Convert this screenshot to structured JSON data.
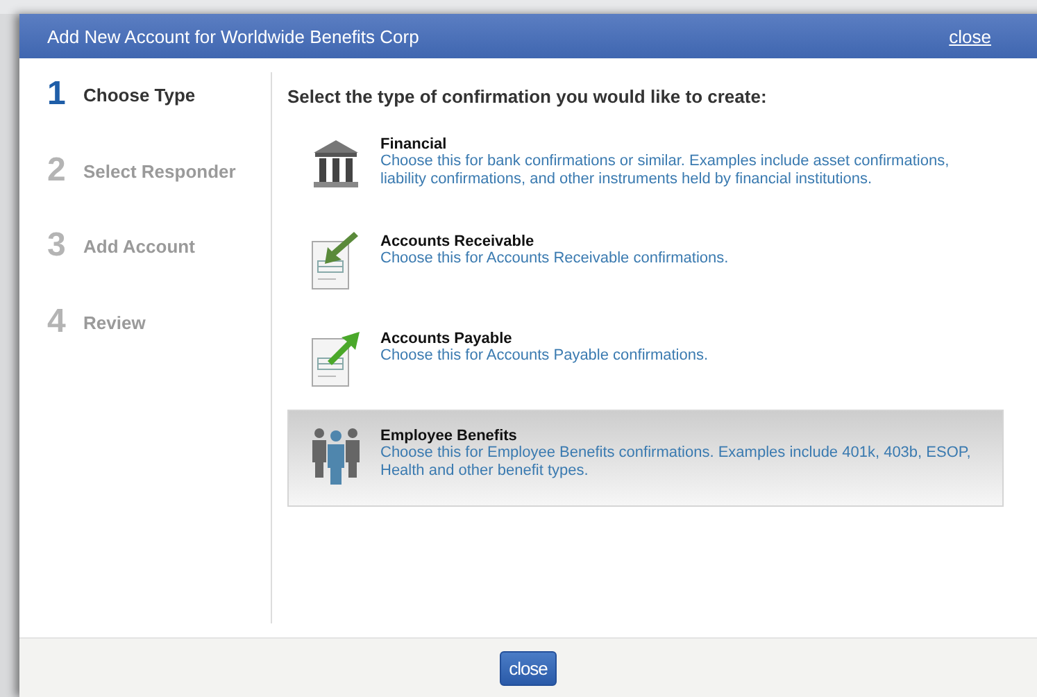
{
  "dialog": {
    "title": "Add New Account for Worldwide Benefits Corp",
    "close_link": "close"
  },
  "steps": [
    {
      "number": "1",
      "label": "Choose Type",
      "selected": true
    },
    {
      "number": "2",
      "label": "Select Responder",
      "selected": false
    },
    {
      "number": "3",
      "label": "Add Account",
      "selected": false
    },
    {
      "number": "4",
      "label": "Review",
      "selected": false
    }
  ],
  "heading": "Select the type of confirmation you would like to create:",
  "options": [
    {
      "kind": "bank",
      "title": "Financial",
      "description": "Choose this for bank confirmations or similar. Examples include asset confirmations, liability confirmations, and other instruments held by financial institutions.",
      "selected": false
    },
    {
      "kind": "receivable",
      "title": "Accounts Receivable",
      "description": "Choose this for Accounts Receivable confirmations.",
      "selected": false
    },
    {
      "kind": "payable",
      "title": "Accounts Payable",
      "description": "Choose this for Accounts Payable confirmations.",
      "selected": false
    },
    {
      "kind": "people",
      "title": "Employee Benefits",
      "description": "Choose this for Employee Benefits confirmations. Examples include 401k, 403b, ESOP, Health and other benefit types.",
      "selected": true
    }
  ],
  "footer_button": "close"
}
